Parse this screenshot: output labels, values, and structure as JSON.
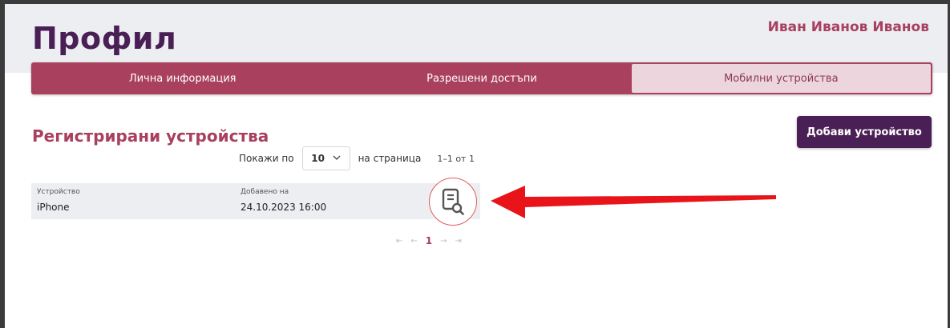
{
  "header": {
    "title": "Профил",
    "user_name": "Иван Иванов Иванов"
  },
  "tabs": [
    {
      "label": "Лична информация",
      "active": false
    },
    {
      "label": "Разрешени достъпи",
      "active": false
    },
    {
      "label": "Мобилни устройства",
      "active": true
    }
  ],
  "section": {
    "title": "Регистрирани устройства",
    "add_button": "Добави устройство"
  },
  "pagination_top": {
    "show_label": "Покажи по",
    "per_page": "10",
    "per_page_suffix": "на страница",
    "range": "1–1 от 1"
  },
  "table": {
    "columns": [
      "Устройство",
      "Добавено на"
    ],
    "rows": [
      {
        "device": "iPhone",
        "added": "24.10.2023 16:00"
      }
    ]
  },
  "pagination_bottom": {
    "first": "⇤",
    "prev": "←",
    "current": "1",
    "next": "→",
    "last": "⇥"
  },
  "colors": {
    "brand_dark": "#4a1f55",
    "brand_accent": "#a8405e",
    "tab_active_bg": "#ecd5dc",
    "annotation_red": "#e8141a"
  },
  "icons": {
    "row_action": "document-search-icon",
    "annotation": "red-arrow-icon",
    "per_page_dropdown": "chevron-down-icon"
  }
}
